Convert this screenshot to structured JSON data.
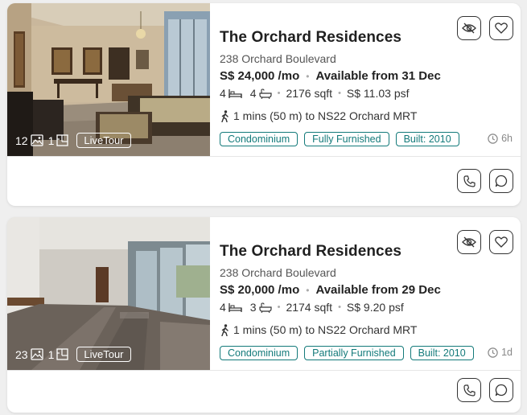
{
  "listings": [
    {
      "title": "The Orchard Residences",
      "address": "238 Orchard Boulevard",
      "price": "S$ 24,000 /mo",
      "availability": "Available from 31 Dec",
      "beds": "4",
      "baths": "4",
      "area": "2176 sqft",
      "psf": "S$ 11.03 psf",
      "mrt": "1 mins (50 m) to NS22 Orchard MRT",
      "tags": [
        "Condominium",
        "Fully Furnished",
        "Built: 2010"
      ],
      "age": "6h",
      "photo_count": "12",
      "floorplan_count": "1",
      "livetour_label": "LiveTour"
    },
    {
      "title": "The Orchard Residences",
      "address": "238 Orchard Boulevard",
      "price": "S$ 20,000 /mo",
      "availability": "Available from 29 Dec",
      "beds": "4",
      "baths": "3",
      "area": "2174 sqft",
      "psf": "S$ 9.20 psf",
      "mrt": "1 mins (50 m) to NS22 Orchard MRT",
      "tags": [
        "Condominium",
        "Partially Furnished",
        "Built: 2010"
      ],
      "age": "1d",
      "photo_count": "23",
      "floorplan_count": "1",
      "livetour_label": "LiveTour"
    }
  ],
  "colors": {
    "accent": "#137a7a",
    "text": "#2b2b2b",
    "muted": "#888888"
  },
  "icons": [
    "eye-off-icon",
    "heart-icon",
    "phone-icon",
    "chat-icon",
    "image-icon",
    "floorplan-icon",
    "bed-icon",
    "bath-icon",
    "walk-icon",
    "clock-icon"
  ]
}
